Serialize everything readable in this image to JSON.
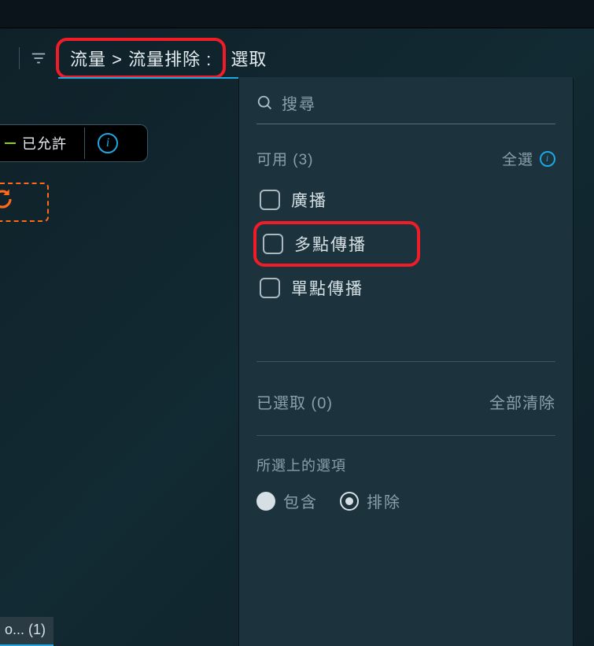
{
  "breadcrumb": {
    "highlighted": "流量 > 流量排除 :",
    "trailing": "選取"
  },
  "allowed": {
    "label": "已允許"
  },
  "bottom_left": "o... (1)",
  "panel": {
    "search_placeholder": "搜尋",
    "available_label": "可用 (3)",
    "select_all": "全選",
    "options": [
      {
        "label": "廣播"
      },
      {
        "label": "多點傳播"
      },
      {
        "label": "單點傳播"
      }
    ],
    "selected_label": "已選取 (0)",
    "clear_all": "全部清除",
    "chosen_title": "所選上的選項",
    "radios": {
      "include": "包含",
      "exclude": "排除"
    }
  }
}
